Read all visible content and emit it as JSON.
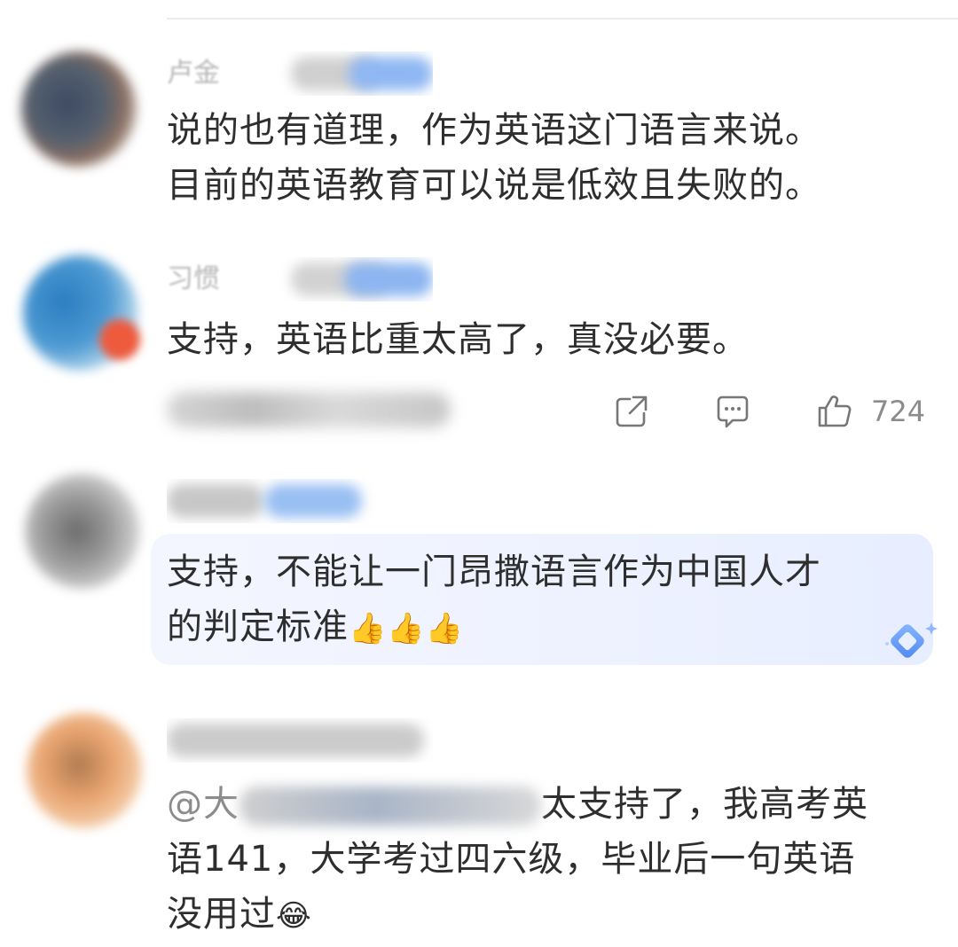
{
  "comments": [
    {
      "username": "卢金",
      "text_lines": [
        "说的也有道理，作为英语这门语言来说。",
        "目前的英语教育可以说是低效且失败的。"
      ]
    },
    {
      "username": "习惯",
      "text_lines": [
        "支持，英语比重太高了，真没必要。"
      ],
      "actions": {
        "share_icon": "share-icon",
        "reply_icon": "comment-icon",
        "like_icon": "thumbs-up-icon",
        "like_count": "724"
      }
    },
    {
      "username": "",
      "text_lines": [
        "支持，不能让一门昂撒语言作为中国人才",
        "的判定标准"
      ],
      "emoji_tail": "👍👍👍"
    },
    {
      "username": "",
      "mention": "@大",
      "text_lines": [
        "太支持了，我高考英",
        "语141，大学考过四六级，毕业后一句英语",
        "没用过"
      ],
      "emoji_tail": "😂"
    }
  ],
  "colors": {
    "highlight": "#eef2ff",
    "muted": "#8c8c8c",
    "text": "#2e2e2e"
  }
}
